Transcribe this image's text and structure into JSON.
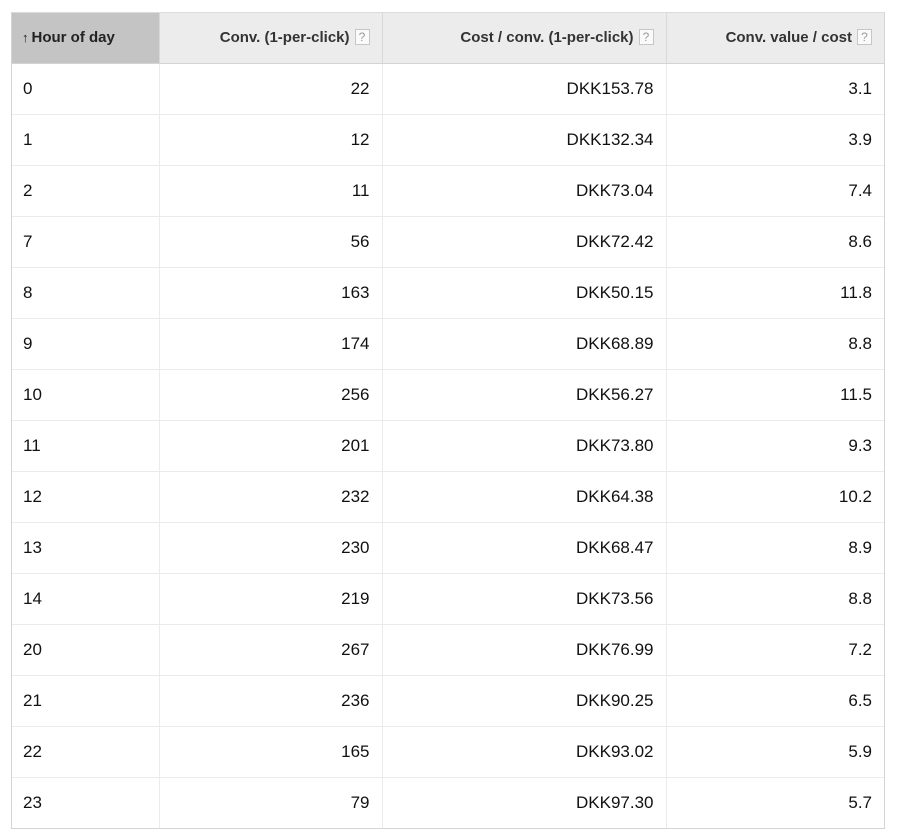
{
  "table": {
    "columns": [
      {
        "label": "Hour of day",
        "sorted": true,
        "sort_direction": "ascending",
        "sort_icon": "arrow-up-icon",
        "help": false
      },
      {
        "label": "Conv. (1-per-click)",
        "help": true,
        "help_icon": "?"
      },
      {
        "label": "Cost / conv. (1-per-click)",
        "help": true,
        "help_icon": "?"
      },
      {
        "label": "Conv. value / cost",
        "help": true,
        "help_icon": "?"
      }
    ],
    "sort_arrow": "↑",
    "rows": [
      {
        "hour": "0",
        "conversions": "22",
        "cost_per_conv": "DKK153.78",
        "value_per_cost": "3.1"
      },
      {
        "hour": "1",
        "conversions": "12",
        "cost_per_conv": "DKK132.34",
        "value_per_cost": "3.9"
      },
      {
        "hour": "2",
        "conversions": "11",
        "cost_per_conv": "DKK73.04",
        "value_per_cost": "7.4"
      },
      {
        "hour": "7",
        "conversions": "56",
        "cost_per_conv": "DKK72.42",
        "value_per_cost": "8.6"
      },
      {
        "hour": "8",
        "conversions": "163",
        "cost_per_conv": "DKK50.15",
        "value_per_cost": "11.8"
      },
      {
        "hour": "9",
        "conversions": "174",
        "cost_per_conv": "DKK68.89",
        "value_per_cost": "8.8"
      },
      {
        "hour": "10",
        "conversions": "256",
        "cost_per_conv": "DKK56.27",
        "value_per_cost": "11.5"
      },
      {
        "hour": "11",
        "conversions": "201",
        "cost_per_conv": "DKK73.80",
        "value_per_cost": "9.3"
      },
      {
        "hour": "12",
        "conversions": "232",
        "cost_per_conv": "DKK64.38",
        "value_per_cost": "10.2"
      },
      {
        "hour": "13",
        "conversions": "230",
        "cost_per_conv": "DKK68.47",
        "value_per_cost": "8.9"
      },
      {
        "hour": "14",
        "conversions": "219",
        "cost_per_conv": "DKK73.56",
        "value_per_cost": "8.8"
      },
      {
        "hour": "20",
        "conversions": "267",
        "cost_per_conv": "DKK76.99",
        "value_per_cost": "7.2"
      },
      {
        "hour": "21",
        "conversions": "236",
        "cost_per_conv": "DKK90.25",
        "value_per_cost": "6.5"
      },
      {
        "hour": "22",
        "conversions": "165",
        "cost_per_conv": "DKK93.02",
        "value_per_cost": "5.9"
      },
      {
        "hour": "23",
        "conversions": "79",
        "cost_per_conv": "DKK97.30",
        "value_per_cost": "5.7"
      }
    ]
  },
  "colors": {
    "header_bg": "#ececec",
    "sorted_header_bg": "#c4c4c4",
    "grid_line": "#ebebeb"
  }
}
